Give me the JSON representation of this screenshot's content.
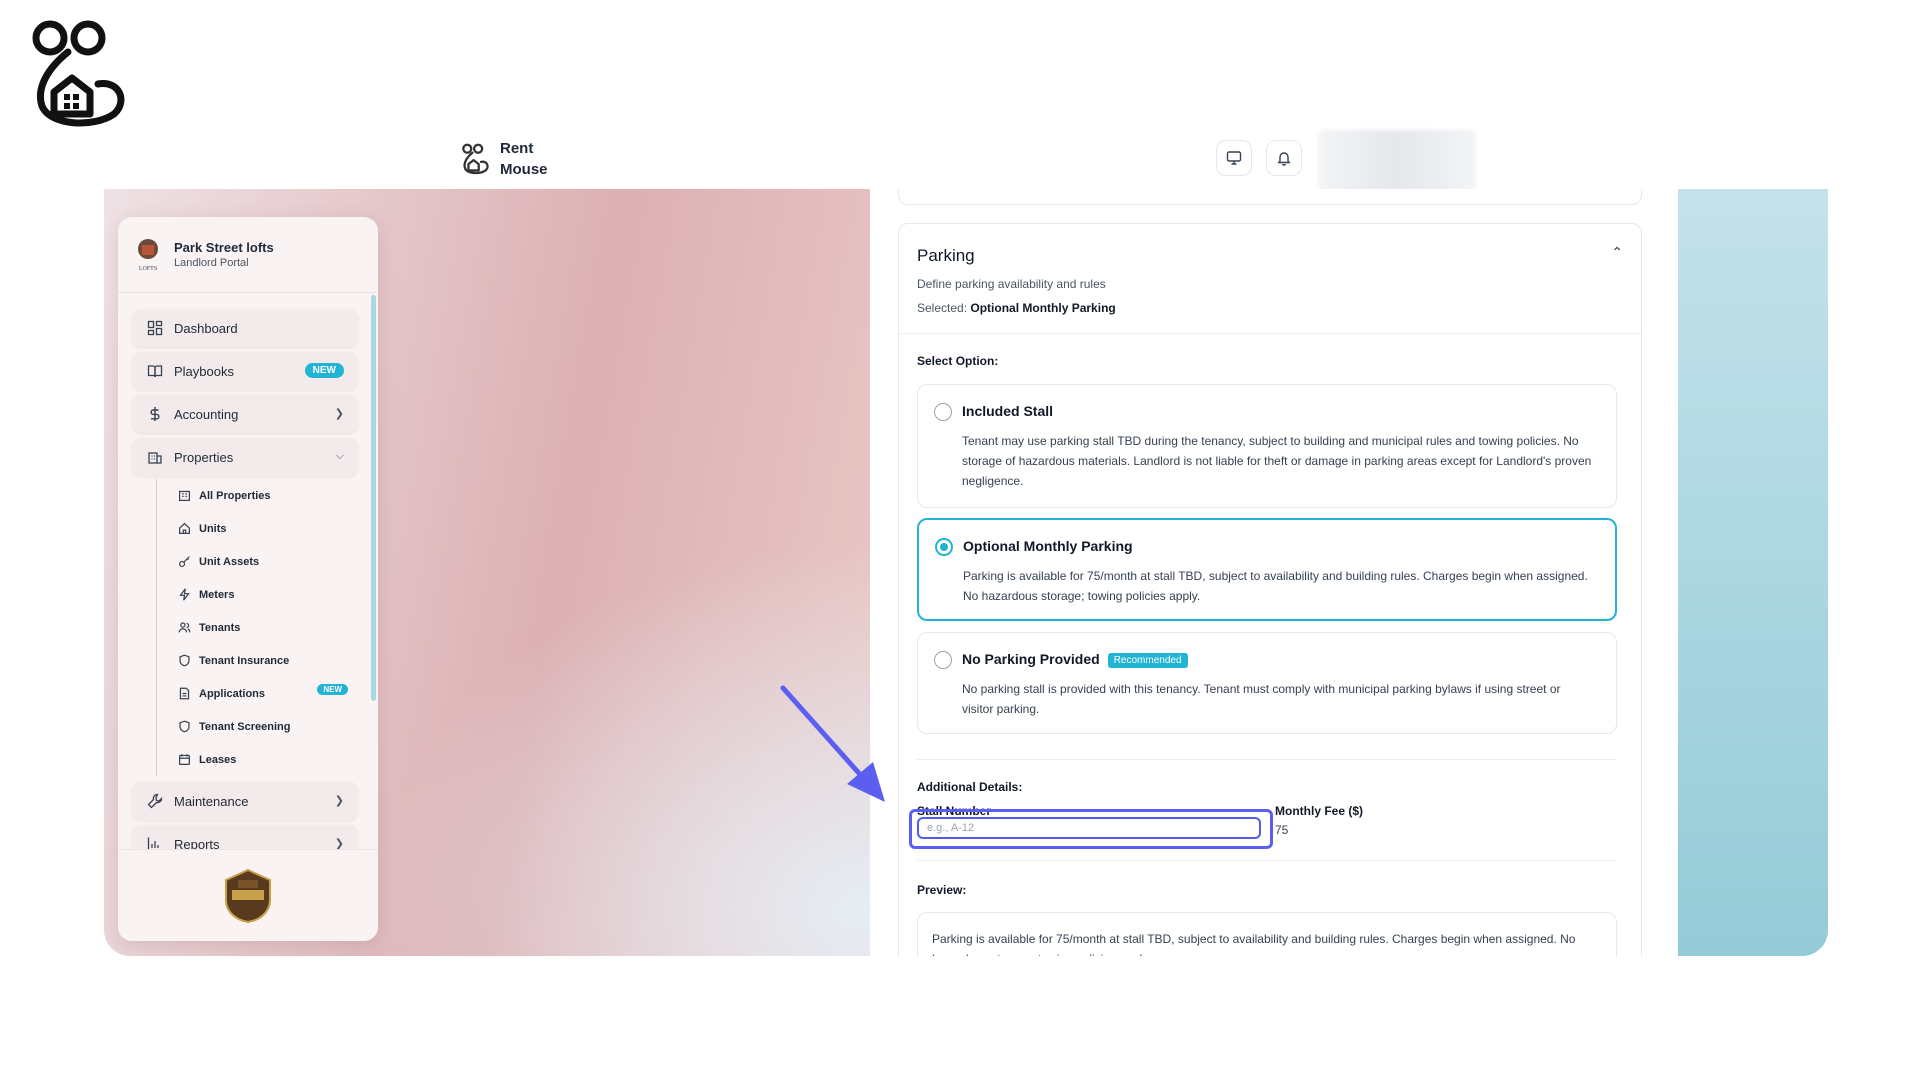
{
  "header": {
    "brand_name": "Rent\nMouse"
  },
  "sidebar": {
    "org_name": "Park Street lofts",
    "org_sub": "Landlord Portal",
    "items": [
      {
        "label": "Dashboard"
      },
      {
        "label": "Playbooks",
        "badge": "NEW"
      },
      {
        "label": "Accounting"
      },
      {
        "label": "Properties"
      }
    ],
    "property_sub": [
      {
        "label": "All Properties"
      },
      {
        "label": "Units"
      },
      {
        "label": "Unit Assets"
      },
      {
        "label": "Meters"
      },
      {
        "label": "Tenants"
      },
      {
        "label": "Tenant Insurance"
      },
      {
        "label": "Applications",
        "badge": "NEW"
      },
      {
        "label": "Tenant Screening"
      },
      {
        "label": "Leases"
      }
    ],
    "bottom_items": [
      {
        "label": "Maintenance"
      },
      {
        "label": "Reports"
      }
    ]
  },
  "parking": {
    "title": "Parking",
    "description": "Define parking availability and rules",
    "selected_prefix": "Selected:",
    "selected_value": "Optional Monthly Parking",
    "select_label": "Select Option:",
    "options": [
      {
        "title": "Included Stall",
        "body": "Tenant may use parking stall TBD during the tenancy, subject to building and municipal rules and towing policies. No storage of hazardous materials. Landlord is not liable for theft or damage in parking areas except for Landlord's proven negligence.",
        "selected": false
      },
      {
        "title": "Optional Monthly Parking",
        "body": "Parking is available for 75/month at stall TBD, subject to availability and building rules. Charges begin when assigned. No hazardous storage; towing policies apply.",
        "selected": true
      },
      {
        "title": "No Parking Provided",
        "badge": "Recommended",
        "body": "No parking stall is provided with this tenancy. Tenant must comply with municipal parking bylaws if using street or visitor parking.",
        "selected": false
      }
    ],
    "additional_label": "Additional Details:",
    "stall_label": "Stall Number",
    "stall_placeholder": "e.g., A-12",
    "stall_value": "",
    "fee_label": "Monthly Fee ($)",
    "fee_value": "75",
    "preview_label": "Preview:",
    "preview_text": "Parking is available for 75/month at stall TBD, subject to availability and building rules. Charges begin when assigned. No hazardous storage; towing policies apply."
  },
  "colors": {
    "accent": "#22b4d4",
    "highlight": "#5b5ef0"
  }
}
